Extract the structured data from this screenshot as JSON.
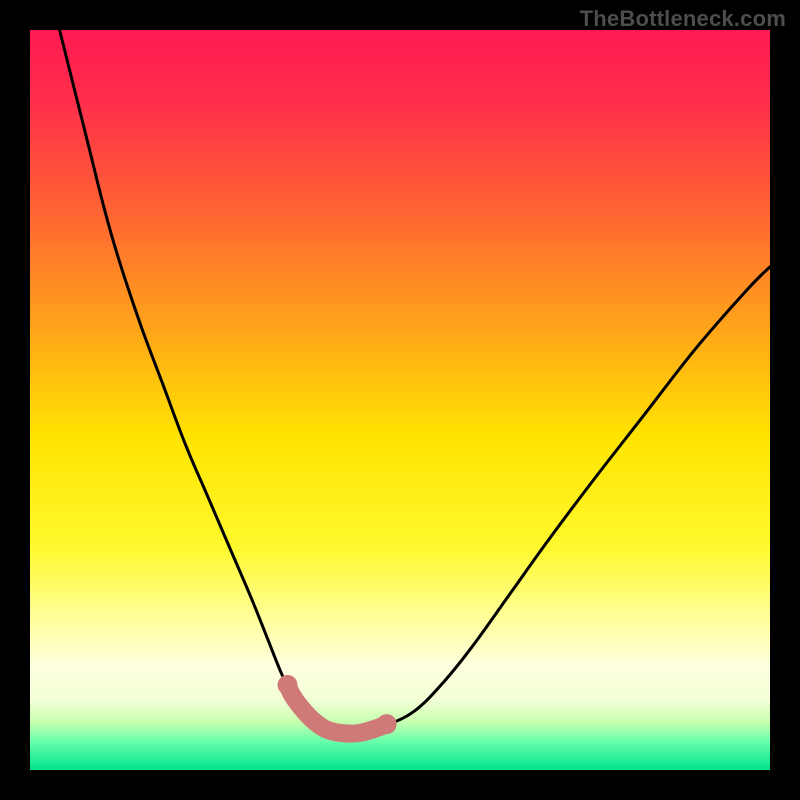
{
  "watermark": "TheBottleneck.com",
  "colors": {
    "frame": "#000000",
    "watermark": "#4d4d4d",
    "curve": "#000000",
    "highlight": "#cf7a78",
    "gradient_stops": [
      {
        "offset": 0.0,
        "color": "#ff1a52"
      },
      {
        "offset": 0.1,
        "color": "#ff2f4a"
      },
      {
        "offset": 0.25,
        "color": "#ff6633"
      },
      {
        "offset": 0.4,
        "color": "#ffa31a"
      },
      {
        "offset": 0.55,
        "color": "#ffe400"
      },
      {
        "offset": 0.7,
        "color": "#fff92e"
      },
      {
        "offset": 0.8,
        "color": "#ffffa0"
      },
      {
        "offset": 0.86,
        "color": "#ffffe0"
      },
      {
        "offset": 0.905,
        "color": "#f3ffd6"
      },
      {
        "offset": 0.935,
        "color": "#c8ffb0"
      },
      {
        "offset": 0.96,
        "color": "#6dffab"
      },
      {
        "offset": 1.0,
        "color": "#00e38c"
      }
    ]
  },
  "chart_data": {
    "type": "line",
    "title": "",
    "xlabel": "",
    "ylabel": "",
    "xlim": [
      0,
      100
    ],
    "ylim": [
      0,
      100
    ],
    "grid": false,
    "series": [
      {
        "name": "bottleneck-curve",
        "x": [
          4,
          6,
          8,
          10,
          12,
          15,
          18,
          21,
          24,
          27,
          30,
          32,
          34,
          35.5,
          37,
          38.5,
          40,
          42,
          44.5,
          48,
          52,
          56,
          60,
          65,
          70,
          76,
          83,
          90,
          97,
          100
        ],
        "y": [
          100,
          92,
          84,
          76,
          69,
          60,
          52,
          44,
          37,
          30,
          23,
          18,
          13,
          10,
          8,
          6.5,
          5.5,
          5,
          5,
          6,
          8,
          12,
          17,
          24,
          31,
          39,
          48,
          57,
          65,
          68
        ]
      },
      {
        "name": "optimal-zone-highlight",
        "x": [
          34.8,
          35.5,
          37,
          38.5,
          40,
          42,
          44.5,
          47,
          48.2
        ],
        "y": [
          11.5,
          10,
          8,
          6.5,
          5.5,
          5,
          5,
          5.7,
          6.2
        ]
      }
    ],
    "annotations": []
  }
}
